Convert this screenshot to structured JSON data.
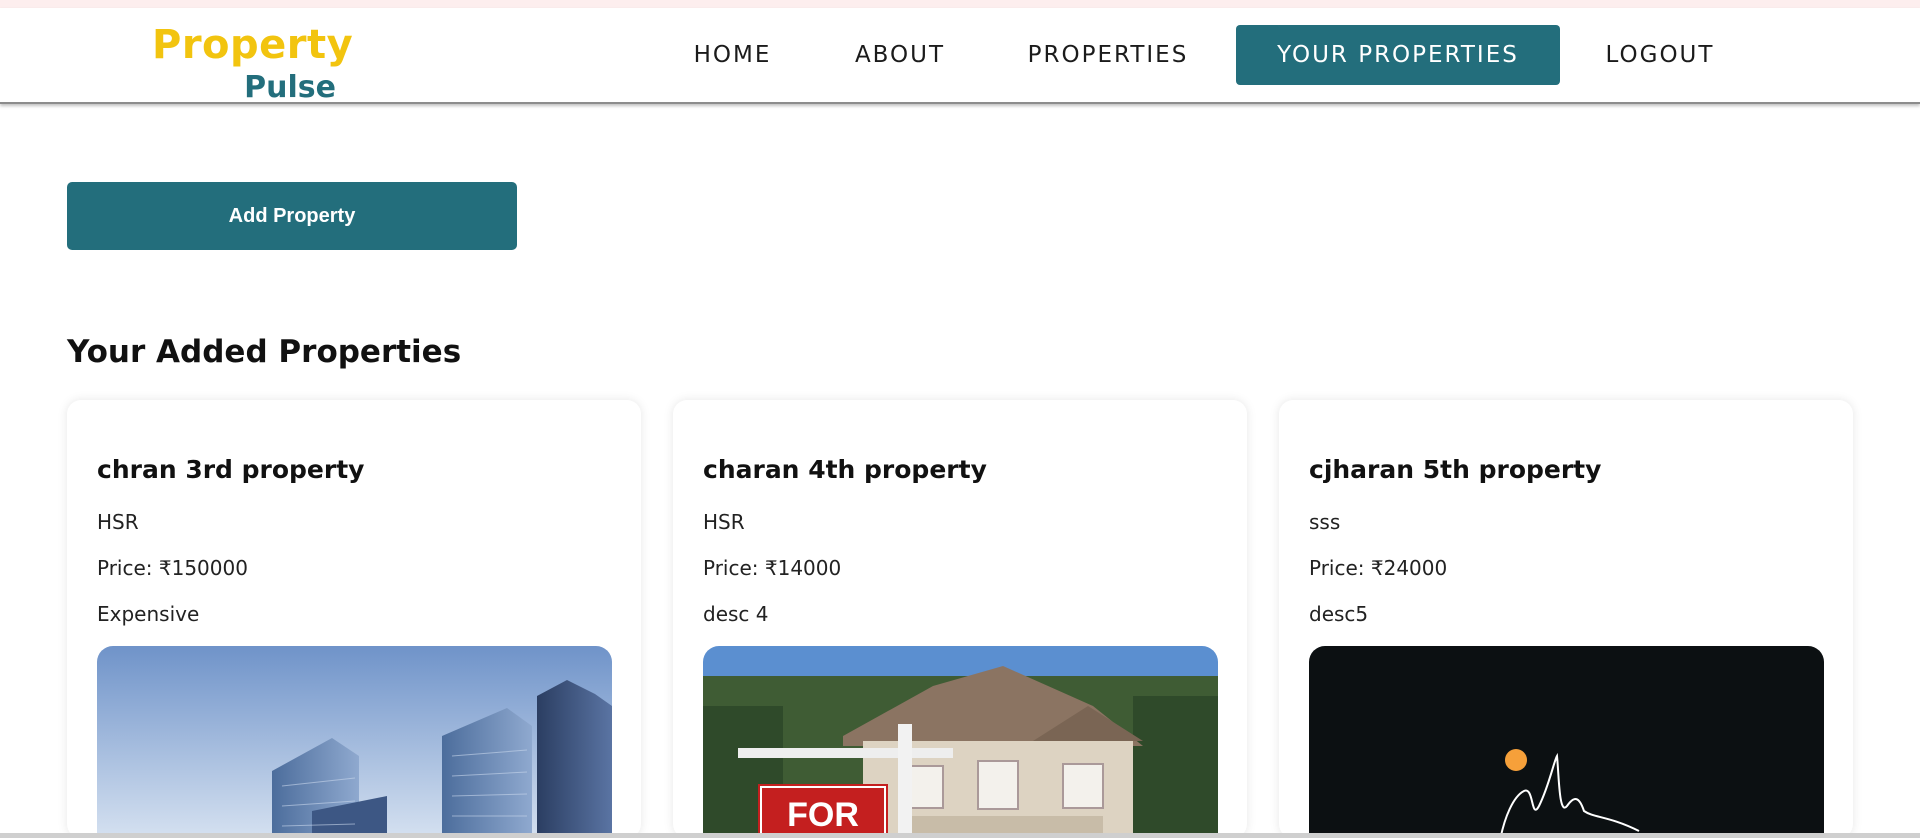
{
  "header": {
    "logo": {
      "top": "Property",
      "bottom": "Pulse"
    },
    "nav": [
      {
        "label": "HOME",
        "active": false
      },
      {
        "label": "ABOUT",
        "active": false
      },
      {
        "label": "PROPERTIES",
        "active": false
      },
      {
        "label": "YOUR PROPERTIES",
        "active": true
      },
      {
        "label": "LOGOUT",
        "active": false
      }
    ]
  },
  "main": {
    "add_button_label": "Add Property",
    "section_title": "Your Added Properties",
    "properties": [
      {
        "title": "chran 3rd property",
        "location": "HSR",
        "price": "Price: ₹150000",
        "description": "Expensive",
        "image": "office-buildings-photo"
      },
      {
        "title": "charan 4th property",
        "location": "HSR",
        "price": "Price: ₹14000",
        "description": "desc 4",
        "image": "house-for-sale-photo"
      },
      {
        "title": "cjharan 5th property",
        "location": "sss",
        "price": "Price: ₹24000",
        "description": "desc5",
        "image": "dark-illustration"
      }
    ]
  },
  "colors": {
    "brand_yellow": "#f2c40f",
    "brand_teal": "#236e7c",
    "card_bg": "#ffffff"
  }
}
